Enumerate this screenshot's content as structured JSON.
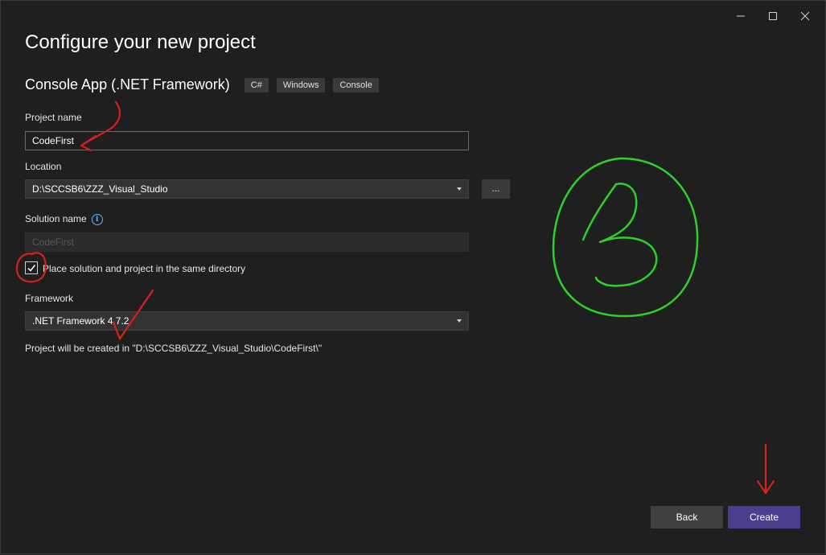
{
  "window": {
    "controls": {
      "minimize_icon": "minimize-icon",
      "maximize_icon": "maximize-icon",
      "close_icon": "close-icon"
    }
  },
  "header": {
    "title": "Configure your new project"
  },
  "template": {
    "name": "Console App (.NET Framework)",
    "tags": [
      "C#",
      "Windows",
      "Console"
    ]
  },
  "form": {
    "project_name_label": "Project name",
    "project_name_value": "CodeFirst",
    "location_label": "Location",
    "location_value": "D:\\SCCSB6\\ZZZ_Visual_Studio",
    "browse_label": "...",
    "solution_name_label": "Solution name",
    "solution_name_value": "CodeFirst",
    "same_dir_checked": true,
    "same_dir_label": "Place solution and project in the same directory",
    "framework_label": "Framework",
    "framework_value": ".NET Framework 4.7.2",
    "summary": "Project will be created in \"D:\\SCCSB6\\ZZZ_Visual_Studio\\CodeFirst\\\""
  },
  "footer": {
    "back_label": "Back",
    "create_label": "Create"
  },
  "colors": {
    "background": "#1f1f1f",
    "accent": "#4a3f8f",
    "annotation_red": "#d42020",
    "annotation_green": "#2ed12a"
  }
}
